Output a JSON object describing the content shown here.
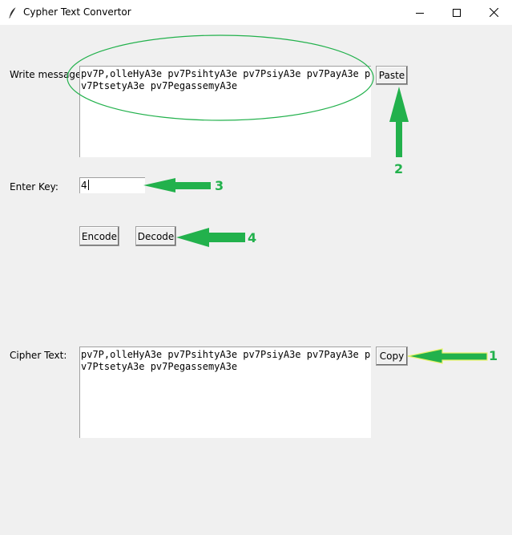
{
  "window": {
    "title": "Cypher Text Convertor",
    "controls": [
      "minimize",
      "maximize",
      "close"
    ]
  },
  "message": {
    "label": "Write message:",
    "value": "pv7P,olleHyA3e pv7PsihtyA3e pv7PsiyA3e pv7PayA3e pv7PtsetyA3e pv7PegassemyA3e",
    "paste_label": "Paste"
  },
  "key": {
    "label": "Enter Key:",
    "value": "4"
  },
  "actions": {
    "encode_label": "Encode",
    "decode_label": "Decode"
  },
  "cipher": {
    "label": "Cipher Text:",
    "value": "pv7P,olleHyA3e pv7PsihtyA3e pv7PsiyA3e pv7PayA3e pv7PtsetyA3e pv7PegassemyA3e",
    "copy_label": "Copy"
  },
  "annotations": {
    "color": "#22b14c",
    "numbers": [
      "1",
      "2",
      "3",
      "4"
    ]
  }
}
